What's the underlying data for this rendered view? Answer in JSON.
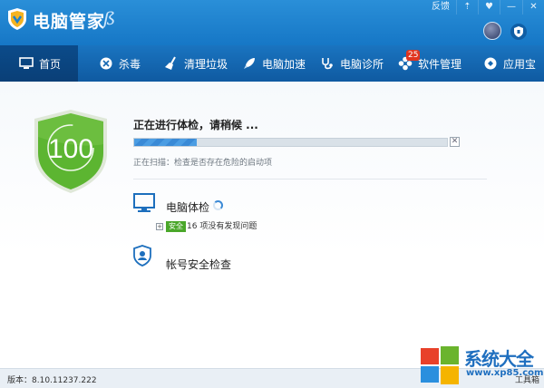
{
  "app": {
    "title": "电脑管家",
    "window_buttons": [
      "反馈",
      "⇡",
      "♥",
      "—",
      "✕"
    ]
  },
  "tabs": [
    {
      "label": "首页",
      "icon": "monitor-icon",
      "active": true
    },
    {
      "label": "杀毒",
      "icon": "virus-icon"
    },
    {
      "label": "清理垃圾",
      "icon": "broom-icon"
    },
    {
      "label": "电脑加速",
      "icon": "rocket-icon"
    },
    {
      "label": "电脑诊所",
      "icon": "stethoscope-icon"
    },
    {
      "label": "软件管理",
      "icon": "apps-icon",
      "badge": "25"
    },
    {
      "label": "应用宝",
      "icon": "store-icon"
    }
  ],
  "main": {
    "score": "100",
    "status_text": "正在进行体检，请稍候 ...",
    "progress": 0.2,
    "close_label": "✕",
    "scan_text": "正在扫描：检查是否存在危险的启动项",
    "check": {
      "title": "电脑体检",
      "expand": "+",
      "safe_badge": "安全",
      "issues_text": "16 项没有发现问题"
    },
    "account": {
      "title": "帐号安全检查"
    }
  },
  "footer": {
    "version": "版本：8.10.11237.222",
    "toolbox": "工具箱"
  },
  "watermark": {
    "brand": "系统大全",
    "url": "www.xp85.com"
  },
  "colors": {
    "titlebar": "#1e82cf",
    "tabbar": "#1467b2",
    "shield_green": "#5cb531",
    "safe_green": "#4aa72a",
    "progress_blue": "#3a8ad6"
  }
}
